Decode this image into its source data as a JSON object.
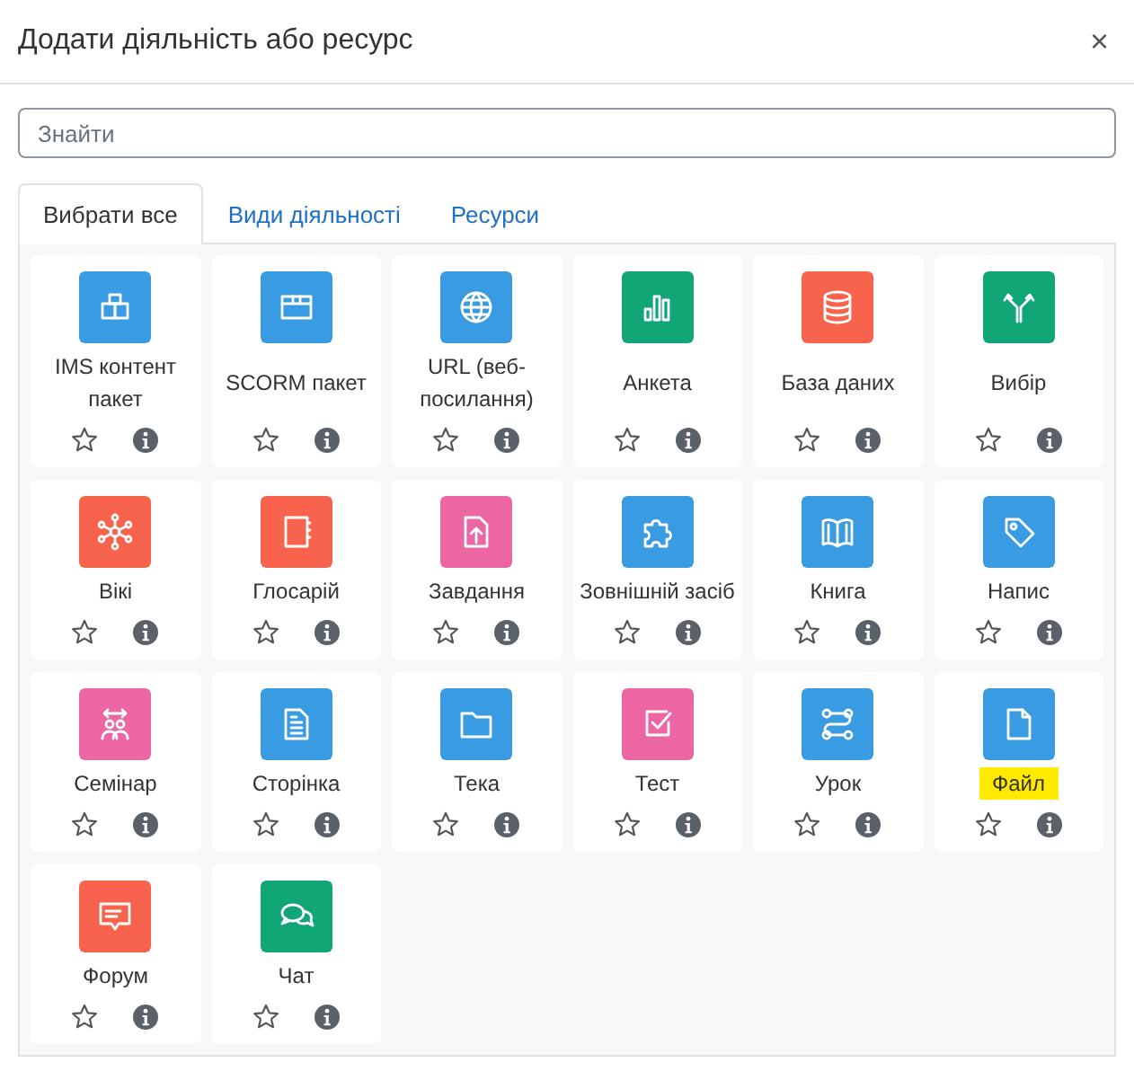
{
  "dialog": {
    "title": "Додати діяльність або ресурс",
    "close": "×"
  },
  "search": {
    "placeholder": "Знайти"
  },
  "tabs": [
    {
      "label": "Вибрати все",
      "selected": true
    },
    {
      "label": "Види діяльності",
      "selected": false
    },
    {
      "label": "Ресурси",
      "selected": false
    }
  ],
  "items": [
    {
      "name": "IMS контент пакет",
      "kind": "package",
      "color": "#399be2",
      "starred": false,
      "highlighted": false
    },
    {
      "name": "SCORM пакет",
      "kind": "box",
      "color": "#399be2",
      "starred": false,
      "highlighted": false
    },
    {
      "name": "URL (веб-посилання)",
      "kind": "globe",
      "color": "#399be2",
      "starred": false,
      "highlighted": false
    },
    {
      "name": "Анкета",
      "kind": "chart",
      "color": "#11a676",
      "starred": false,
      "highlighted": false
    },
    {
      "name": "База даних",
      "kind": "database",
      "color": "#f7634d",
      "starred": false,
      "highlighted": false
    },
    {
      "name": "Вибір",
      "kind": "fork",
      "color": "#11a676",
      "starred": false,
      "highlighted": false
    },
    {
      "name": "Вікі",
      "kind": "network",
      "color": "#f7634d",
      "starred": false,
      "highlighted": false
    },
    {
      "name": "Глосарій",
      "kind": "notebook",
      "color": "#f7634d",
      "starred": false,
      "highlighted": false
    },
    {
      "name": "Завдання",
      "kind": "upload",
      "color": "#eb66a2",
      "starred": false,
      "highlighted": false
    },
    {
      "name": "Зовнішній засіб",
      "kind": "puzzle",
      "color": "#399be2",
      "starred": false,
      "highlighted": false
    },
    {
      "name": "Книга",
      "kind": "book",
      "color": "#399be2",
      "starred": false,
      "highlighted": false
    },
    {
      "name": "Напис",
      "kind": "tag",
      "color": "#399be2",
      "starred": false,
      "highlighted": false
    },
    {
      "name": "Семінар",
      "kind": "people",
      "color": "#eb66a2",
      "starred": false,
      "highlighted": false
    },
    {
      "name": "Сторінка",
      "kind": "page",
      "color": "#399be2",
      "starred": false,
      "highlighted": false
    },
    {
      "name": "Тека",
      "kind": "folder",
      "color": "#399be2",
      "starred": false,
      "highlighted": false
    },
    {
      "name": "Тест",
      "kind": "checkbox",
      "color": "#eb66a2",
      "starred": false,
      "highlighted": false
    },
    {
      "name": "Урок",
      "kind": "route",
      "color": "#399be2",
      "starred": false,
      "highlighted": false
    },
    {
      "name": "Файл",
      "kind": "file",
      "color": "#399be2",
      "starred": false,
      "highlighted": true
    },
    {
      "name": "Форум",
      "kind": "message",
      "color": "#f7634d",
      "starred": false,
      "highlighted": false
    },
    {
      "name": "Чат",
      "kind": "chat",
      "color": "#11a676",
      "starred": false,
      "highlighted": false
    }
  ]
}
